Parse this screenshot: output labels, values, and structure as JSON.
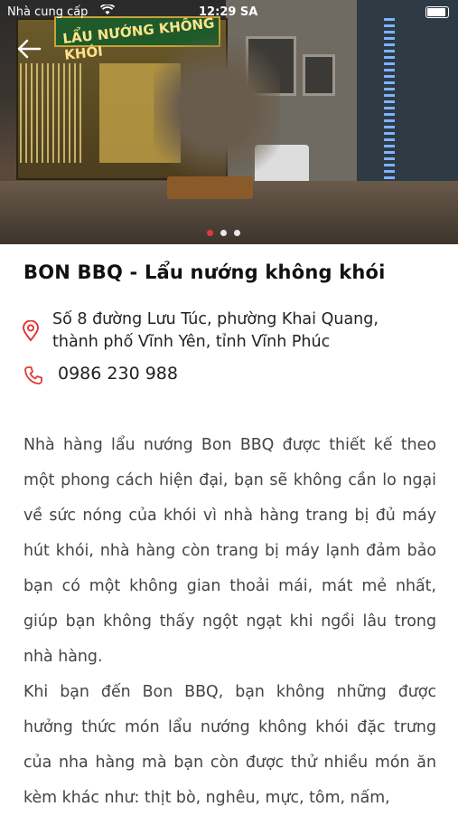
{
  "status_bar": {
    "carrier": "Nhà cung cấp",
    "time": "12:29 SA"
  },
  "hero": {
    "sign_text": "LẨU NƯỚNG KHÔNG KHÓI",
    "slide_count": 3,
    "active_slide": 1
  },
  "colors": {
    "accent": "#e03a3a",
    "text": "#222222",
    "body_text": "#444444"
  },
  "restaurant": {
    "title": "BON BBQ - Lẩu nướng không khói",
    "address": "Số 8 đường Lưu Túc, phường Khai Quang,\nthành phố Vĩnh Yên, tỉnh Vĩnh Phúc",
    "phone": "0986 230 988",
    "description": "Nhà hàng lẩu nướng Bon BBQ được thiết kế theo một phong cách hiện đại, bạn sẽ không cần lo ngại về sức nóng của khói vì nhà hàng trang bị đủ máy hút khói, nhà hàng còn trang bị máy lạnh đảm bảo bạn có một không gian thoải mái, mát mẻ nhất, giúp bạn không thấy ngột ngạt khi ngồi lâu trong nhà hàng.\nKhi bạn đến Bon BBQ, bạn không những được hưởng thức món lẩu nướng không khói đặc trưng của nha hàng mà bạn còn được thử nhiều món ăn kèm khác như: thịt bò, nghêu, mực, tôm, nấm,"
  },
  "icons": {
    "back": "back-arrow-icon",
    "address": "location-pin-icon",
    "phone": "phone-icon",
    "wifi": "wifi-icon",
    "battery": "battery-icon"
  }
}
